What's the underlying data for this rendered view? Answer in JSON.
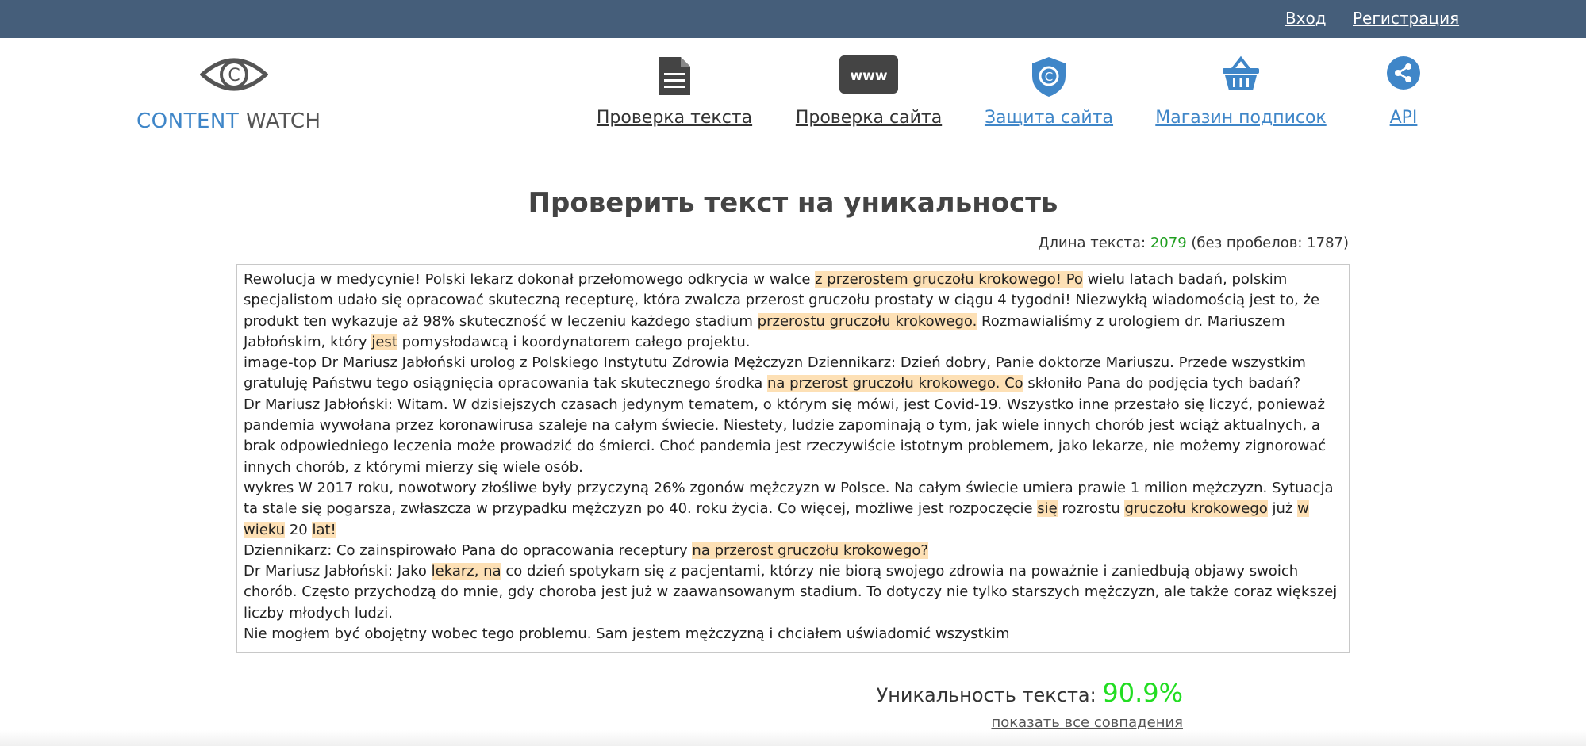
{
  "header": {
    "login": "Вход",
    "register": "Регистрация"
  },
  "logo": {
    "part1": "CONTENT",
    "part2": " WATCH"
  },
  "nav": [
    {
      "label": "Проверка текста",
      "icon": "document-icon"
    },
    {
      "label": "Проверка сайта",
      "icon": "www-icon"
    },
    {
      "label": "Защита сайта",
      "icon": "shield-copyright-icon"
    },
    {
      "label": "Магазин подписок",
      "icon": "basket-icon"
    },
    {
      "label": "API",
      "icon": "api-share-icon"
    }
  ],
  "page_title": "Проверить текст на уникальность",
  "length": {
    "label": "Длина текста: ",
    "value": "2079",
    "no_spaces": " (без пробелов: 1787)"
  },
  "text": {
    "p1": [
      {
        "t": "Rewolucja w medycynie! Polski lekarz dokonał przełomowego odkrycia w walce "
      },
      {
        "t": "z przerostem gruczołu krokowego! Po",
        "hl": true
      },
      {
        "t": " wielu latach badań, polskim specjalistom udało się opracować skuteczną recepturę, która zwalcza przerost gruczołu prostaty w ciągu 4 tygodni! Niezwykłą wiadomością jest to, że produkt ten wykazuje aż 98% skuteczność w leczeniu każdego stadium "
      },
      {
        "t": "przerostu gruczołu krokowego.",
        "hl": true
      },
      {
        "t": " Rozmawialiśmy z urologiem dr. Mariuszem Jabłońskim, który "
      },
      {
        "t": "jest",
        "hl": true
      },
      {
        "t": " pomysłodawcą i koordynatorem całego projektu."
      }
    ],
    "p2": [
      {
        "t": "image-top Dr Mariusz Jabłoński urolog z Polskiego Instytutu Zdrowia Mężczyzn Dziennikarz: Dzień dobry, Panie doktorze Mariuszu. Przede wszystkim gratuluję Państwu tego osiągnięcia opracowania tak skutecznego środka "
      },
      {
        "t": "na przerost gruczołu krokowego. Co",
        "hl": true
      },
      {
        "t": " skłoniło Pana do podjęcia tych badań?"
      }
    ],
    "p3": [
      {
        "t": "Dr Mariusz Jabłoński: Witam. W dzisiejszych czasach jedynym tematem, o którym się mówi, jest Covid-19. Wszystko inne przestało się liczyć, ponieważ pandemia wywołana przez koronawirusa szaleje na całym świecie. Niestety, ludzie zapominają o tym, jak wiele innych chorób jest wciąż aktualnych, a brak odpowiedniego leczenia może prowadzić do śmierci. Choć pandemia jest rzeczywiście istotnym problemem, jako lekarze, nie możemy zignorować innych chorób, z którymi mierzy się wiele osób."
      }
    ],
    "p4": [
      {
        "t": "wykres W 2017 roku, nowotwory złośliwe były przyczyną 26% zgonów mężczyzn w Polsce. Na całym świecie umiera prawie 1 milion mężczyzn. Sytuacja ta stale się pogarsza, zwłaszcza w przypadku mężczyzn po 40. roku życia. Co więcej, możliwe jest rozpoczęcie "
      },
      {
        "t": "się",
        "hl": true
      },
      {
        "t": " rozrostu "
      },
      {
        "t": "gruczołu krokowego",
        "hl": true
      },
      {
        "t": " już "
      },
      {
        "t": "w wieku",
        "hl": true
      },
      {
        "t": " 20 "
      },
      {
        "t": "lat!",
        "hl": true
      }
    ],
    "p5": [
      {
        "t": "Dziennikarz: Co zainspirowało Pana do opracowania receptury "
      },
      {
        "t": "na przerost gruczołu krokowego?",
        "hl": true
      }
    ],
    "p6": [
      {
        "t": "Dr Mariusz Jabłoński: Jako "
      },
      {
        "t": "lekarz, na",
        "hl": true
      },
      {
        "t": " co dzień spotykam się z pacjentami, którzy nie biorą swojego zdrowia na poważnie i zaniedbują objawy swoich chorób. Często przychodzą do mnie, gdy choroba jest już w zaawansowanym stadium. To dotyczy nie tylko starszych mężczyzn, ale także coraz większej liczby młodych ludzi."
      }
    ],
    "p7": [
      {
        "t": "Nie mogłem być obojętny wobec tego problemu. Sam jestem mężczyzną i chciałem uświadomić wszystkim"
      }
    ]
  },
  "uniqueness": {
    "label": "Уникальность текста: ",
    "value": "90.9%"
  },
  "show_matches": "показать все совпадения",
  "colors": {
    "header_bg": "#455e7a",
    "accent_blue": "#3f86c8",
    "highlight": "#fde0b5",
    "uniq_green": "#22dd22"
  }
}
